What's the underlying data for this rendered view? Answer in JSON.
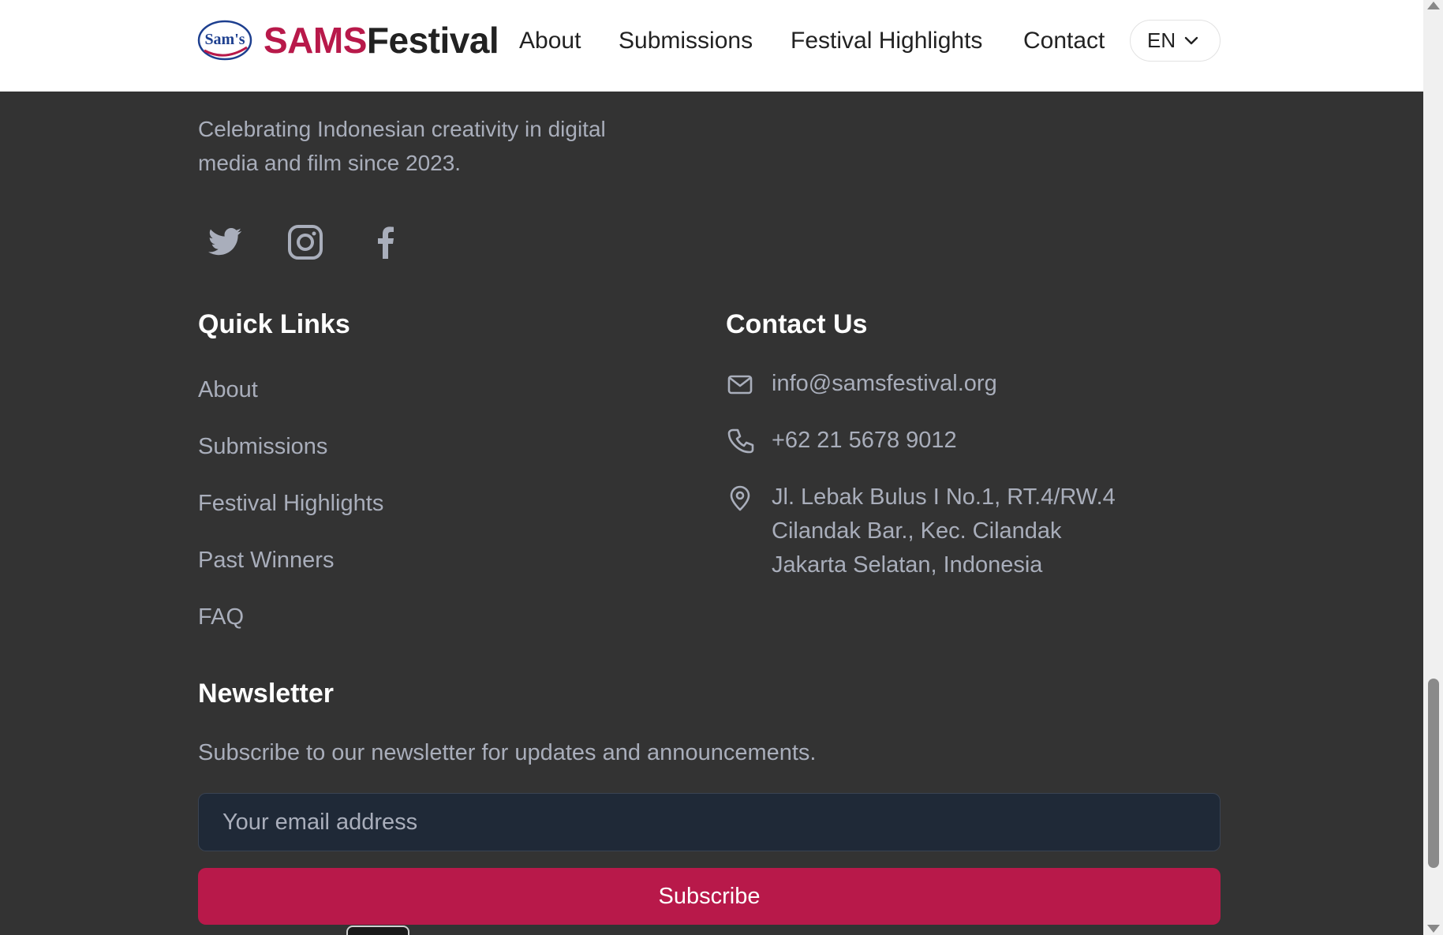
{
  "header": {
    "logo_text": "Sam's",
    "brand_part1": "SAMS",
    "brand_part2": "Festival",
    "nav": [
      "About",
      "Submissions",
      "Festival Highlights",
      "Contact"
    ],
    "language": "EN"
  },
  "footer": {
    "tagline": "Celebrating Indonesian creativity in digital media and film since 2023.",
    "social_icons": [
      "twitter-icon",
      "instagram-icon",
      "facebook-icon"
    ],
    "quick_links_heading": "Quick Links",
    "quick_links": [
      "About",
      "Submissions",
      "Festival Highlights",
      "Past Winners",
      "FAQ"
    ],
    "contact_heading": "Contact Us",
    "contact": {
      "email": "info@samsfestival.org",
      "phone": "+62 21 5678 9012",
      "address_line1": "Jl. Lebak Bulus I No.1, RT.4/RW.4",
      "address_line2": "Cilandak Bar., Kec. Cilandak",
      "address_line3": "Jakarta Selatan, Indonesia"
    },
    "newsletter_heading": "Newsletter",
    "newsletter_desc": "Subscribe to our newsletter for updates and announcements.",
    "email_placeholder": "Your email address",
    "subscribe_label": "Subscribe"
  },
  "colors": {
    "accent": "#b8194a",
    "footer_bg": "#333333",
    "muted_text": "#a9aebb",
    "input_bg": "#1f2937"
  }
}
